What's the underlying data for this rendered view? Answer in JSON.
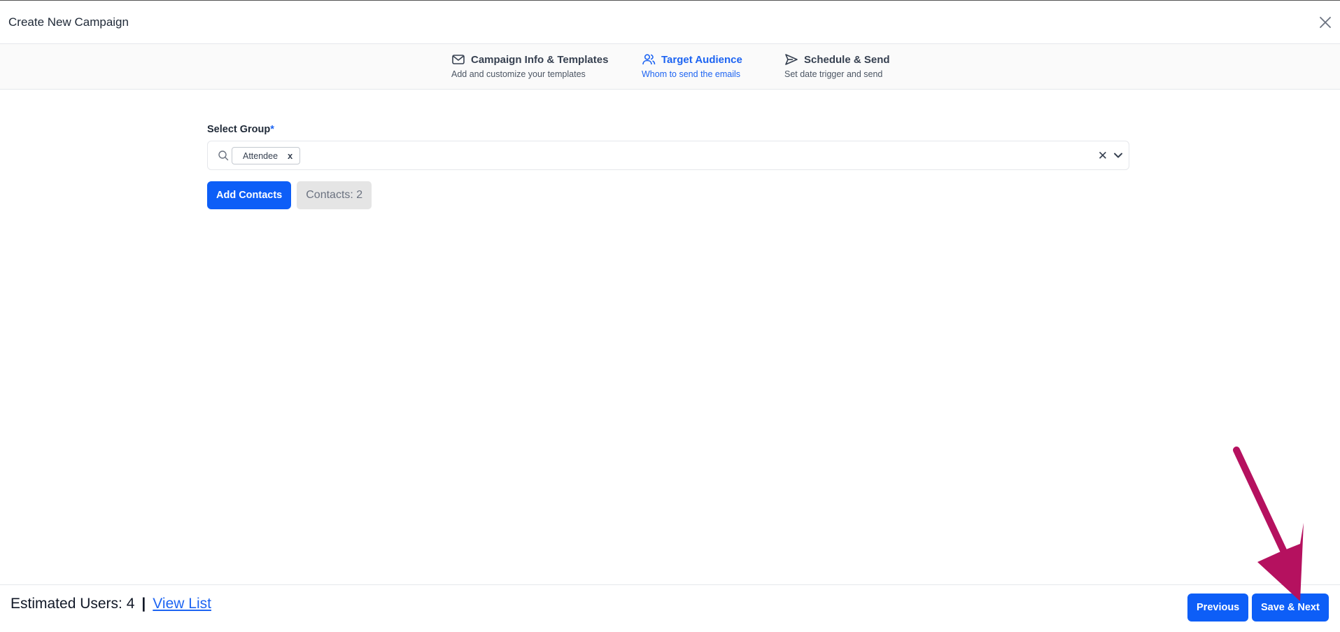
{
  "header": {
    "title": "Create New Campaign",
    "close_icon": "close-icon"
  },
  "steps": [
    {
      "title": "Campaign Info & Templates",
      "subtitle": "Add and customize your templates",
      "icon": "envelope-icon",
      "active": false
    },
    {
      "title": "Target Audience",
      "subtitle": "Whom to send the emails",
      "icon": "users-icon",
      "active": true
    },
    {
      "title": "Schedule & Send",
      "subtitle": "Set date trigger and send",
      "icon": "send-icon",
      "active": false
    }
  ],
  "form": {
    "select_group_label": "Select Group",
    "required_mark": "*",
    "selected_chip": "Attendee",
    "chip_remove": "x",
    "clear_symbol": "✕"
  },
  "actions": {
    "add_contacts_label": "Add Contacts",
    "contacts_count": "Contacts: 2"
  },
  "footer": {
    "estimated_users": "Estimated Users: 4",
    "separator": "|",
    "view_list_label": "View List",
    "previous_label": "Previous",
    "save_next_label": "Save & Next"
  },
  "colors": {
    "primary": "#0d5ef7",
    "active_step": "#1d64f2",
    "annotation_arrow": "#b5115f"
  }
}
